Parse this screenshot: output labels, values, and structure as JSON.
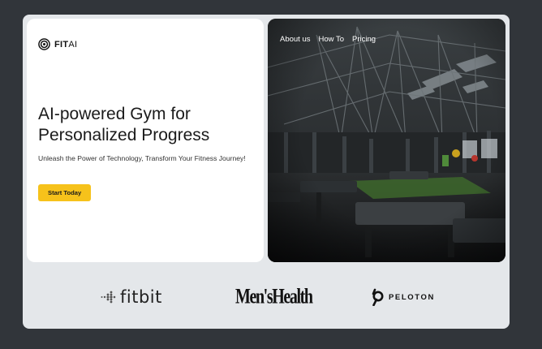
{
  "brand": {
    "logo_bold": "FIT",
    "logo_light": "AI"
  },
  "hero": {
    "headline": "AI-powered Gym for Personalized Progress",
    "subtext": "Unleash the Power of Technology, Transform Your Fitness Journey!",
    "cta_label": "Start Today",
    "cta_color": "#f6c21b"
  },
  "nav": {
    "items": [
      "About us",
      "How To",
      "Pricing"
    ]
  },
  "partners": {
    "fitbit": "fitbit",
    "menshealth": "Men'sHealth",
    "peloton": "PELOTON"
  },
  "colors": {
    "background": "#31353a",
    "panel": "#e4e7ea",
    "accent": "#f6c21b"
  }
}
